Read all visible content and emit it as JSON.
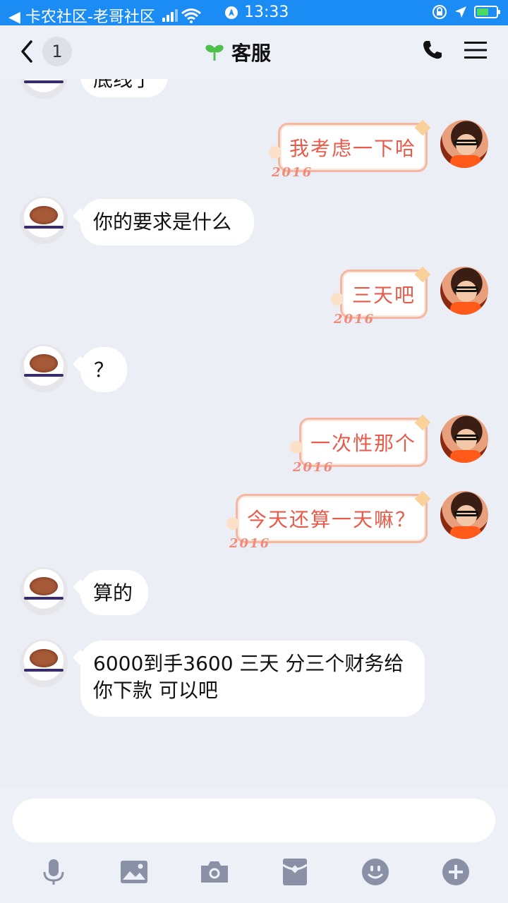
{
  "status_bar": {
    "carrier": "◀ 卡农社区-老哥社区",
    "time": "13:33"
  },
  "nav": {
    "unread_count": "1",
    "title": "客服"
  },
  "messages": [
    {
      "side": "in",
      "text": "底线了",
      "partial": true
    },
    {
      "side": "out",
      "text": "我考虑一下哈",
      "badge": "2016"
    },
    {
      "side": "in",
      "text": "你的要求是什么"
    },
    {
      "side": "out",
      "text": "三天吧",
      "badge": "2016"
    },
    {
      "side": "in",
      "text": "？"
    },
    {
      "side": "out",
      "text": "一次性那个",
      "badge": "2016"
    },
    {
      "side": "out",
      "text": "今天还算一天嘛？",
      "badge": "2016"
    },
    {
      "side": "in",
      "text": "算的"
    },
    {
      "side": "in",
      "text": "6000到手3600  三天 分三个财务给你下款 可以吧"
    }
  ],
  "input": {
    "placeholder": ""
  },
  "toolbar": {
    "icons": [
      "mic-icon",
      "image-icon",
      "camera-icon",
      "red-packet-icon",
      "emoji-icon",
      "plus-icon"
    ]
  },
  "colors": {
    "status_bar": "#1c8cf5",
    "background": "#eceef6",
    "outgoing_text": "#e85a4a",
    "outgoing_border": "#f6b7a2",
    "icon": "#8a91a6"
  }
}
